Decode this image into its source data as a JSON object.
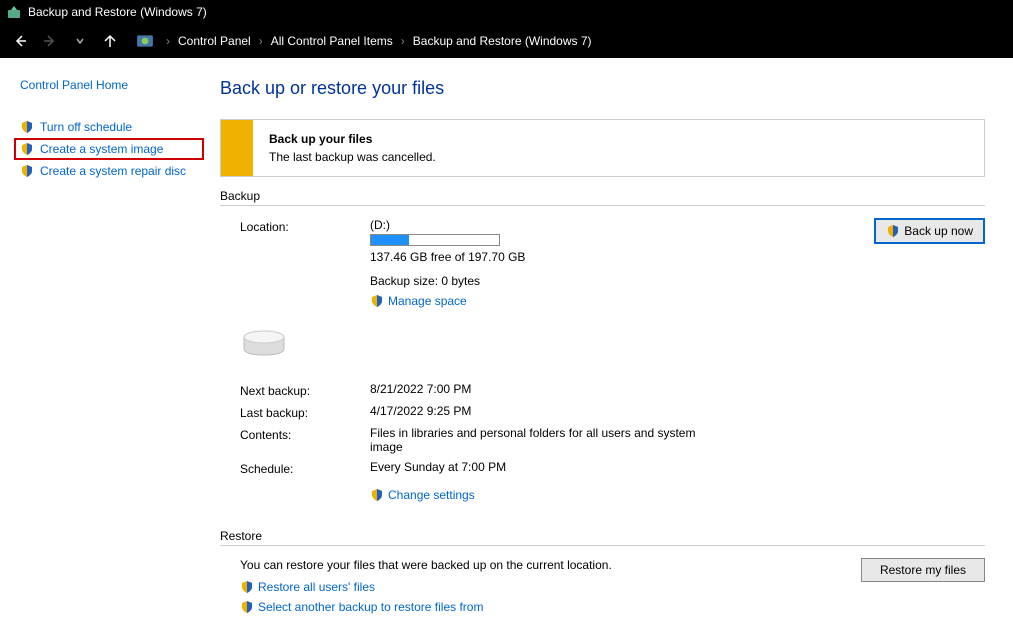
{
  "window": {
    "title": "Backup and Restore (Windows 7)"
  },
  "breadcrumb": {
    "items": [
      "Control Panel",
      "All Control Panel Items",
      "Backup and Restore (Windows 7)"
    ]
  },
  "sidebar": {
    "heading": "Control Panel Home",
    "links": [
      {
        "label": "Turn off schedule"
      },
      {
        "label": "Create a system image",
        "highlighted": true
      },
      {
        "label": "Create a system repair disc"
      }
    ]
  },
  "content": {
    "page_title": "Back up or restore your files",
    "alert": {
      "title": "Back up your files",
      "text": "The last backup was cancelled."
    },
    "backup_section": {
      "heading": "Backup",
      "location_label": "Location:",
      "location_value": "(D:)",
      "disk_free": "137.46 GB free of 197.70 GB",
      "disk_progress_pct": 30,
      "backup_size_label": "Backup size: 0 bytes",
      "manage_space": "Manage space",
      "backup_now_btn": "Back up now",
      "rows": {
        "next_backup_label": "Next backup:",
        "next_backup_value": "8/21/2022 7:00 PM",
        "last_backup_label": "Last backup:",
        "last_backup_value": "4/17/2022 9:25 PM",
        "contents_label": "Contents:",
        "contents_value": "Files in libraries and personal folders for all users and system image",
        "schedule_label": "Schedule:",
        "schedule_value": "Every Sunday at 7:00 PM",
        "change_settings": "Change settings"
      }
    },
    "restore_section": {
      "heading": "Restore",
      "text": "You can restore your files that were backed up on the current location.",
      "restore_btn": "Restore my files",
      "links": {
        "restore_all": "Restore all users' files",
        "select_another": "Select another backup to restore files from"
      }
    }
  }
}
